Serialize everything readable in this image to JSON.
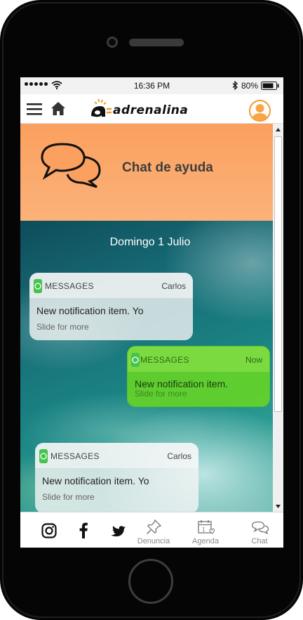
{
  "status_bar": {
    "time": "16:36 PM",
    "battery": "80%",
    "icons": [
      "signal-dots-icon",
      "wifi-icon",
      "bluetooth-icon",
      "battery-icon"
    ]
  },
  "header": {
    "logo_text": "adrenalina",
    "icons": [
      "menu-icon",
      "home-icon",
      "avatar-icon"
    ]
  },
  "banner": {
    "title": "Chat de ayuda",
    "icon": "chat-bubbles-icon"
  },
  "chat": {
    "date": "Domingo 1 Julio",
    "messages": [
      {
        "app": "MESSAGES",
        "sender": "Carlos",
        "body": "New notification item. Yo",
        "hint": "Slide for more",
        "style": "white"
      },
      {
        "app": "MESSAGES",
        "sender": "Now",
        "body": "New notification item.",
        "hint": "Slide for more",
        "style": "green"
      },
      {
        "app": "MESSAGES",
        "sender": "Carlos",
        "body": "New notification item. Yo",
        "hint": "Slide for more",
        "style": "white"
      }
    ]
  },
  "bottom_bar": {
    "social": [
      "instagram-icon",
      "facebook-icon",
      "twitter-icon"
    ],
    "items": [
      {
        "label": "Denuncia",
        "icon": "pin-icon"
      },
      {
        "label": "Agenda",
        "icon": "calendar-icon"
      },
      {
        "label": "Chat",
        "icon": "chat-icon"
      }
    ]
  },
  "colors": {
    "accent_orange": "#f39a32",
    "banner_orange": "#fba05e",
    "message_green": "#64d228"
  }
}
